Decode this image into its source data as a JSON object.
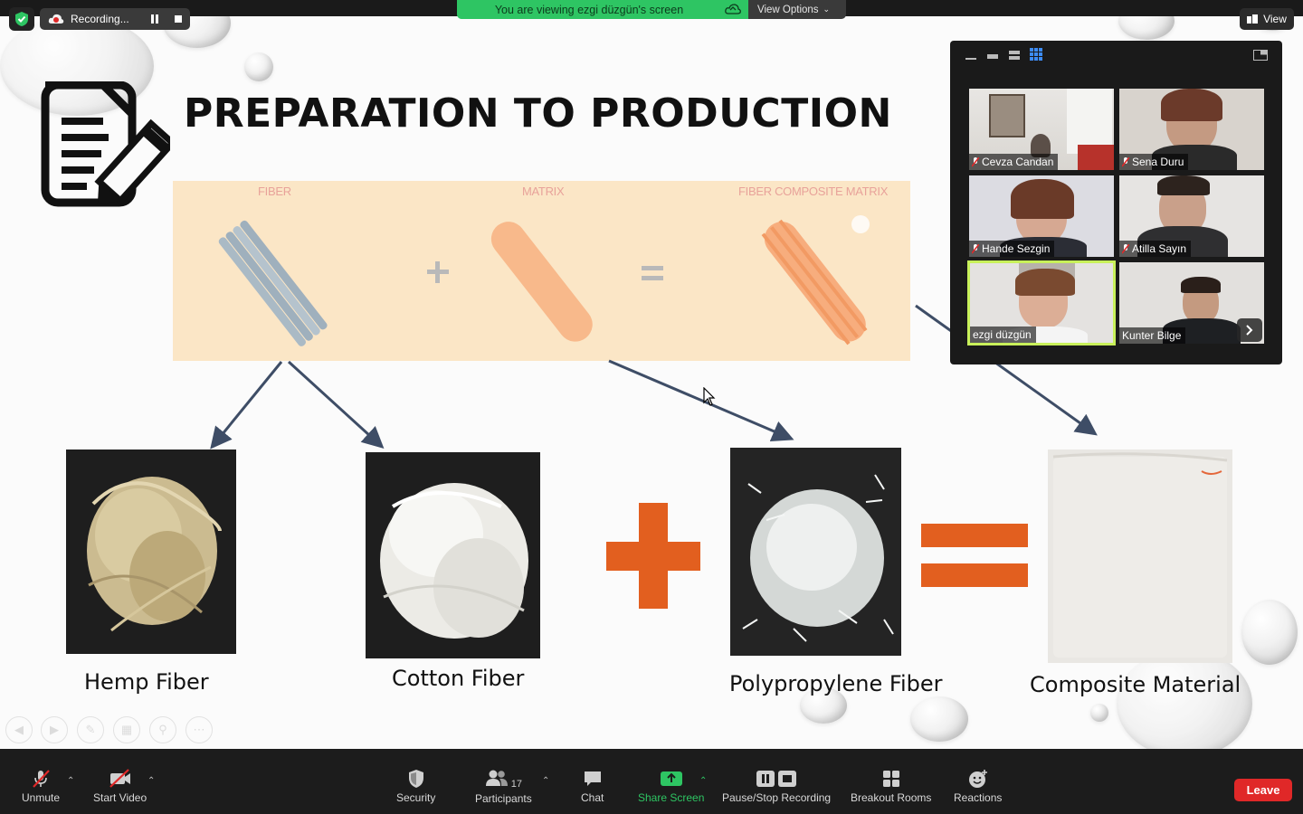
{
  "top": {
    "recording_label": "Recording...",
    "viewing_banner": "You are viewing ezgi düzgün's screen",
    "view_options": "View Options",
    "view_button": "View"
  },
  "slide": {
    "title": "PREPARATION TO PRODUCTION",
    "banner_labels": [
      "FIBER",
      "MATRIX",
      "FIBER COMPOSITE MATRIX"
    ],
    "captions": {
      "hemp": "Hemp Fiber",
      "cotton": "Cotton Fiber",
      "polypropylene": "Polypropylene Fiber",
      "composite": "Composite Material"
    }
  },
  "gallery": {
    "participants": [
      {
        "name": "Cevza Candan",
        "muted": true
      },
      {
        "name": "Sena Duru",
        "muted": true
      },
      {
        "name": "Hande Sezgin",
        "muted": true
      },
      {
        "name": "Atilla Sayın",
        "muted": true
      },
      {
        "name": "ezgi düzgün",
        "muted": false,
        "active_speaker": true
      },
      {
        "name": "Kunter Bilge",
        "muted": false
      }
    ]
  },
  "toolbar": {
    "unmute": "Unmute",
    "start_video": "Start Video",
    "security": "Security",
    "participants": "Participants",
    "participant_count": "17",
    "chat": "Chat",
    "share_screen": "Share Screen",
    "pause_stop_recording": "Pause/Stop Recording",
    "breakout_rooms": "Breakout Rooms",
    "reactions": "Reactions",
    "leave": "Leave"
  },
  "colors": {
    "accent_green": "#2ec563",
    "leave_red": "#e02828",
    "slide_orange": "#e25f1f",
    "active_speaker_border": "#c8f05a"
  }
}
